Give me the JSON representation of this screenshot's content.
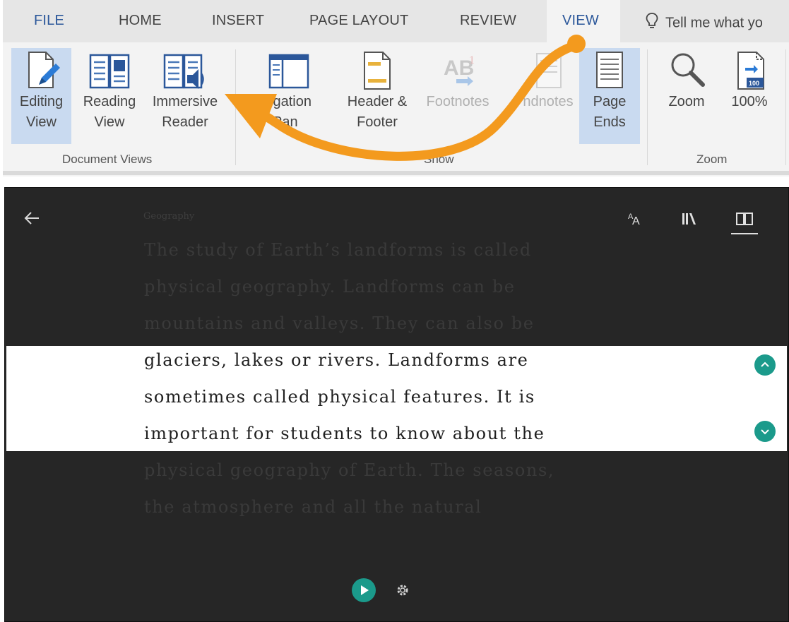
{
  "ribbon": {
    "tabs": [
      {
        "label": "FILE"
      },
      {
        "label": "HOME"
      },
      {
        "label": "INSERT"
      },
      {
        "label": "PAGE LAYOUT"
      },
      {
        "label": "REVIEW"
      },
      {
        "label": "VIEW",
        "active": true
      }
    ],
    "tell_me": "Tell me what yo",
    "buttons": {
      "editing_view": {
        "line1": "Editing",
        "line2": "View",
        "selected": true
      },
      "reading_view": {
        "line1": "Reading",
        "line2": "View"
      },
      "immersive_reader": {
        "line1": "Immersive",
        "line2": "Reader"
      },
      "navigation_pane": {
        "line1": "vigation",
        "line2": "Pan"
      },
      "header_footer": {
        "line1": "Header &",
        "line2": "Footer"
      },
      "footnotes": {
        "line1": "Footnotes"
      },
      "endnotes": {
        "line1": "ndnotes"
      },
      "page_ends": {
        "line1": "Page",
        "line2": "Ends",
        "selected": true
      },
      "zoom": {
        "line1": "Zoom"
      },
      "hundred": {
        "line1": "100%",
        "badge": "100"
      }
    },
    "groups": {
      "document_views": "Document Views",
      "show": "Show",
      "zoom": "Zoom"
    },
    "accent_color": "#2b579a",
    "arrow_color": "#f39a1e"
  },
  "reader": {
    "category": "Geography",
    "lines": [
      "The study of Earth’s landforms is called",
      "physical geography. Landforms can be",
      "mountains and valleys. They can also be",
      "glaciers, lakes or rivers. Landforms are",
      "sometimes called physical features. It is",
      "important for students to know about the",
      "physical geography of Earth. The seasons,",
      "the atmosphere and all the natural"
    ],
    "accent_color": "#1b9a8b",
    "icons": [
      "back-arrow-icon",
      "text-preferences-icon",
      "grammar-options-icon",
      "reading-preferences-icon",
      "line-focus-up-icon",
      "line-focus-down-icon",
      "play-icon",
      "settings-gear-icon"
    ]
  }
}
